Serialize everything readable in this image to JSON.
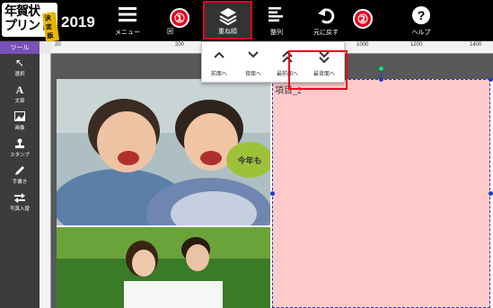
{
  "logo": {
    "line1": "年賀状",
    "line2": "プリント",
    "badge": "決定版",
    "year": "2019"
  },
  "header": {
    "menu_label": "メニュー",
    "layer_label": "重ね順",
    "align_label": "整列",
    "undo_label": "元に戻す",
    "help_label": "ヘルプ",
    "hidden_label": "回"
  },
  "annotations": {
    "step1": "①",
    "step2": "②"
  },
  "ruler": {
    "numbers": [
      "20",
      "200",
      "400",
      "600",
      "800",
      "1000",
      "1200",
      "1400"
    ]
  },
  "sidebar": {
    "title": "ツール",
    "tools": [
      {
        "label": "選択",
        "icon": "pointer-icon"
      },
      {
        "label": "文章",
        "icon": "text-icon"
      },
      {
        "label": "画像",
        "icon": "image-icon"
      },
      {
        "label": "スタンプ",
        "icon": "stamp-icon"
      },
      {
        "label": "手書き",
        "icon": "pen-icon"
      },
      {
        "label": "写真入替",
        "icon": "swap-icon"
      }
    ]
  },
  "dropdown": {
    "items": [
      {
        "label": "前面へ",
        "icon": "chevron-up-icon"
      },
      {
        "label": "背面へ",
        "icon": "chevron-down-icon"
      },
      {
        "label": "最前面へ",
        "icon": "double-chevron-up-icon"
      },
      {
        "label": "最背面へ",
        "icon": "double-chevron-down-icon"
      }
    ]
  },
  "canvas": {
    "item_label": "項目_2",
    "photo_bubble": "今年も"
  },
  "colors": {
    "accent": "#7a51b8",
    "highlight": "#e8001c",
    "selection": "#1a3ec8",
    "pink_box": "#ffcaca"
  }
}
